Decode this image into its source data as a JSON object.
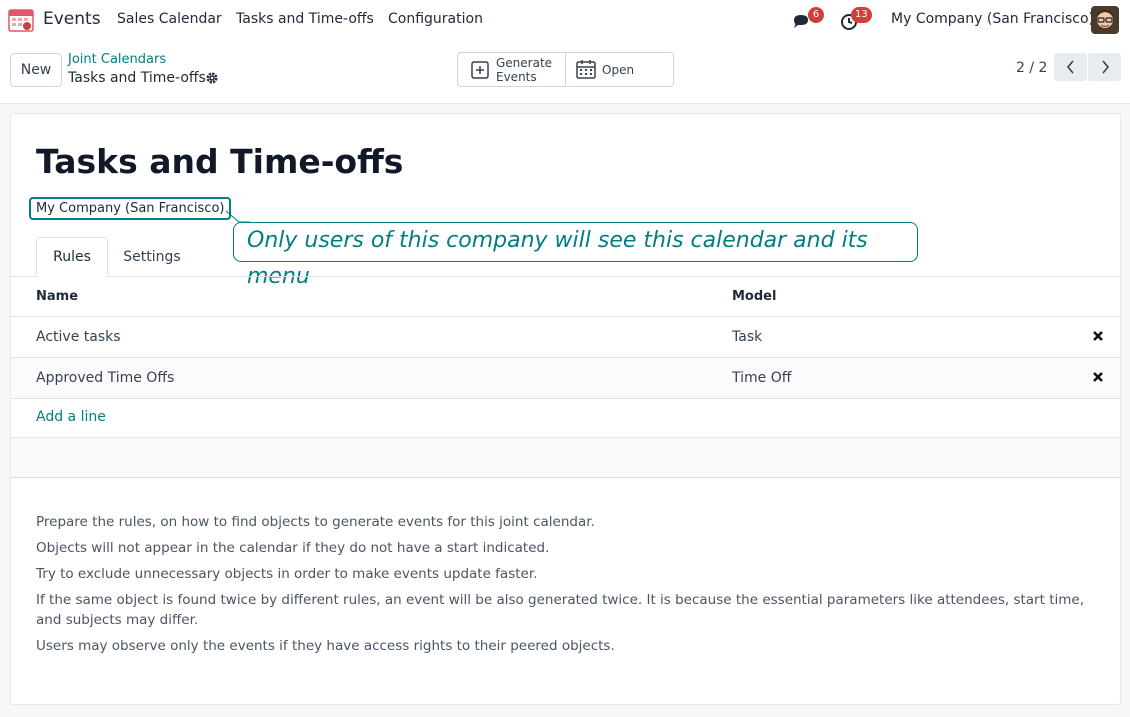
{
  "navbar": {
    "app_name": "Events",
    "menu": [
      "Sales Calendar",
      "Tasks and Time-offs",
      "Configuration"
    ],
    "messages_count": "6",
    "activities_count": "13",
    "company": "My Company (San Francisco)"
  },
  "control_panel": {
    "new_label": "New",
    "breadcrumb_parent": "Joint Calendars",
    "breadcrumb_current": "Tasks and Time-offs",
    "generate_label": "Generate Events",
    "open_label": "Open",
    "pager": "2 / 2"
  },
  "form": {
    "title": "Tasks and Time-offs",
    "company": "My Company (San Francisco)",
    "company_tooltip": "Only users of this company will see this calendar and its menu",
    "tabs": [
      "Rules",
      "Settings"
    ],
    "columns": [
      "Name",
      "Model"
    ],
    "rows": [
      {
        "name": "Active tasks",
        "model": "Task"
      },
      {
        "name": "Approved Time Offs",
        "model": "Time Off"
      }
    ],
    "add_line": "Add a line",
    "help": [
      "Prepare the rules, on how to find objects to generate events for this joint calendar.",
      "Objects will not appear in the calendar if they do not have a start indicated.",
      "Try to exclude unnecessary objects in order to make events update faster.",
      "If the same object is found twice by different rules, an event will be also generated twice. It is because the essential parameters like attendees, start time, and subjects may differ.",
      "Users may observe only the events if they have access rights to their peered objects."
    ]
  },
  "colors": {
    "accent": "#017e84",
    "badge": "#d23f3a"
  }
}
